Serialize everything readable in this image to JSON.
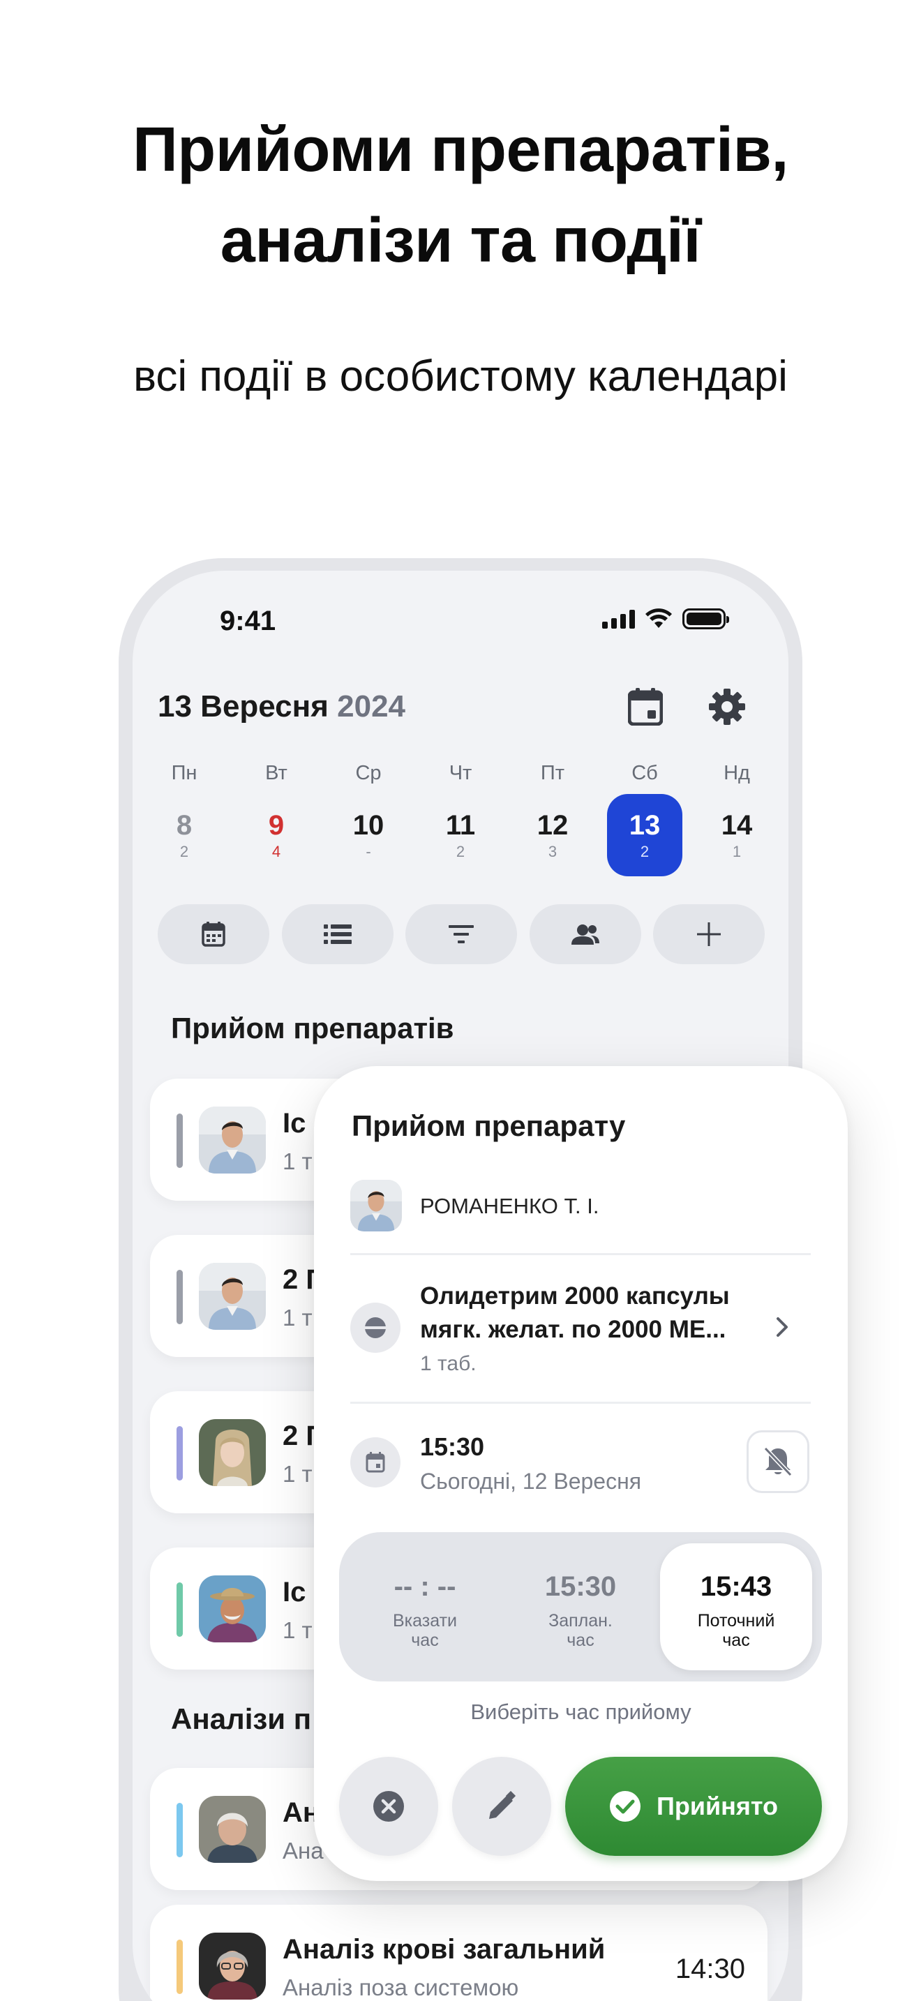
{
  "promo": {
    "headline_line1": "Прийоми препаратів,",
    "headline_line2": "аналізи та події",
    "subheadline": "всі події в особистому календарі"
  },
  "status_bar": {
    "time": "9:41",
    "icons": [
      "signal-icon",
      "wifi-icon",
      "battery-icon"
    ]
  },
  "header": {
    "date": "13 Вересня",
    "year": "2024",
    "calendar_button_icon": "calendar-icon",
    "settings_button_icon": "gear-icon"
  },
  "week": [
    {
      "name": "Пн",
      "date": "8",
      "count": "2",
      "state": "past"
    },
    {
      "name": "Вт",
      "date": "9",
      "count": "4",
      "state": "red"
    },
    {
      "name": "Ср",
      "date": "10",
      "count": "-",
      "state": "normal"
    },
    {
      "name": "Чт",
      "date": "11",
      "count": "2",
      "state": "normal"
    },
    {
      "name": "Пт",
      "date": "12",
      "count": "3",
      "state": "normal"
    },
    {
      "name": "Сб",
      "date": "13",
      "count": "2",
      "state": "selected"
    },
    {
      "name": "Нд",
      "date": "14",
      "count": "1",
      "state": "normal"
    }
  ],
  "actions": [
    "calendar-icon",
    "list-icon",
    "filter-icon",
    "people-icon",
    "plus-icon"
  ],
  "sections": {
    "medications": "Прийом препаратів",
    "analyses": "Аналізи п"
  },
  "medication_cards": [
    {
      "title": "Іс",
      "subtitle": "1 т",
      "bar_color": "#9a9ea8",
      "avatar": "man-blue-shirt"
    },
    {
      "title": "2 П",
      "subtitle": "1 т",
      "bar_color": "#9a9ea8",
      "avatar": "man-blue-shirt"
    },
    {
      "title": "2 П",
      "subtitle": "1 т",
      "bar_color": "#9c9ee0",
      "avatar": "girl-blonde"
    },
    {
      "title": "Іс",
      "subtitle": "1 т",
      "bar_color": "#6fc9a8",
      "avatar": "old-man-hat"
    }
  ],
  "analysis_cards": [
    {
      "title": "Ан",
      "subtitle": "Ана",
      "time": "",
      "bar_color": "#7cc8ef",
      "avatar": "old-woman"
    },
    {
      "title": "Аналіз крові загальний",
      "subtitle": "Аналіз поза системою",
      "time": "14:30",
      "bar_color": "#f5c97a",
      "avatar": "woman-glasses"
    }
  ],
  "modal": {
    "title": "Прийом препарату",
    "person": "РОМАНЕНКО Т. І.",
    "drug_line1": "Олидетрим 2000 капсулы",
    "drug_line2": "мягк. желат. по 2000 МЕ...",
    "dose": "1 таб.",
    "time": "15:30",
    "date": "Сьогодні, 12 Вересня",
    "time_options": [
      {
        "value": "-- : --",
        "label": "Вказати час",
        "active": false
      },
      {
        "value": "15:30",
        "label": "Заплан. час",
        "active": false
      },
      {
        "value": "15:43",
        "label": "Поточний час",
        "active": true
      }
    ],
    "hint": "Виберіть час прийому",
    "accept_label": "Прийнято",
    "colors": {
      "accent_green": "#3a9a3e",
      "selected_blue": "#1f45d6"
    }
  }
}
